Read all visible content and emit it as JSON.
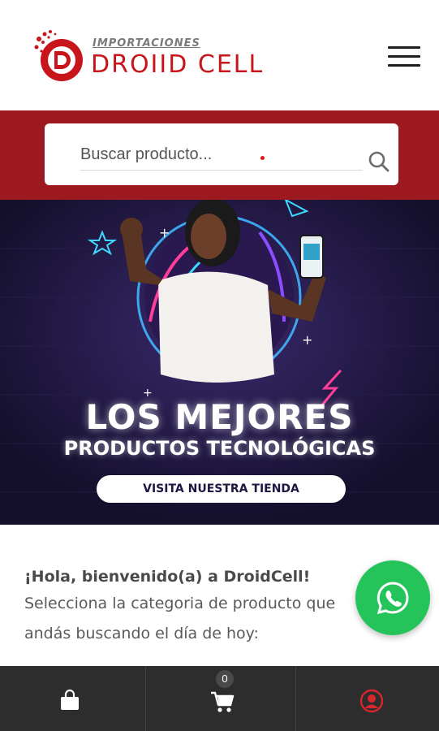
{
  "header": {
    "logo_subtitle": "IMPORTACIONES",
    "logo_name": "DROIID CELL",
    "menu_icon": "hamburger-menu-icon"
  },
  "search": {
    "placeholder": "Buscar producto...",
    "icon": "search-icon"
  },
  "banner": {
    "headline": "LOS MEJORES",
    "subheadline": "PRODUCTOS TECNOLÓGICAS",
    "cta_label": "VISITA NUESTRA TIENDA"
  },
  "welcome": {
    "title": "¡Hola, bienvenido(a) a DroidCell!",
    "line1": "Selecciona la categoria de producto que",
    "line2": "andás buscando el día de hoy:"
  },
  "whatsapp": {
    "icon": "whatsapp-icon"
  },
  "bottom_bar": {
    "cart_count": "0",
    "icons": [
      "shopping-bag-icon",
      "cart-icon",
      "user-account-icon"
    ]
  },
  "colors": {
    "brand_red": "#c8151b",
    "band_red": "#9c1a1f",
    "banner_bg": "#1a1433",
    "whatsapp_green": "#25c45a",
    "bottom_bar": "#2d2d2d"
  }
}
